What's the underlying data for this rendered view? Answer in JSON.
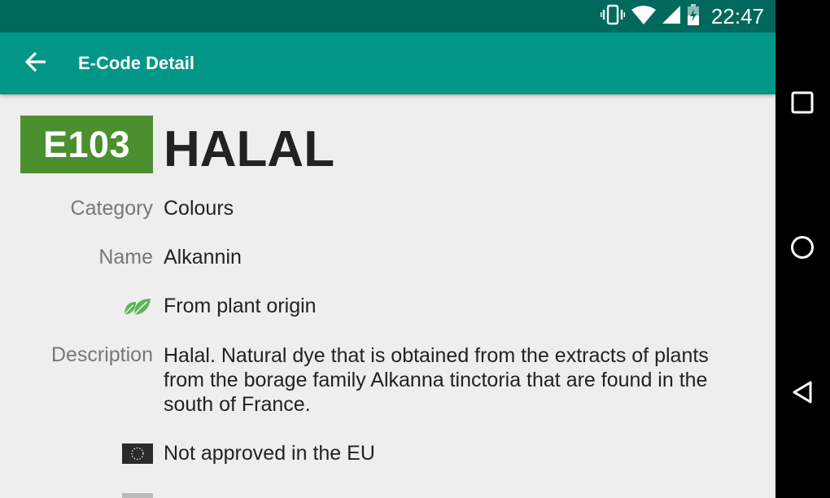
{
  "status_bar": {
    "time": "22:47",
    "icons": [
      "vibrate-icon",
      "wifi-icon",
      "cell-signal-icon",
      "battery-charging-icon"
    ]
  },
  "app_bar": {
    "title": "E-Code Detail",
    "back_icon": "arrow-back-icon"
  },
  "detail": {
    "code": "E103",
    "status": "HALAL",
    "category_label": "Category",
    "category_value": "Colours",
    "name_label": "Name",
    "name_value": "Alkannin",
    "origin_icon": "leaf-icon",
    "origin_text": "From plant origin",
    "description_label": "Description",
    "description_text": "Halal. Natural dye that is obtained from the extracts of plants from the borage family Alkanna tinctoria that are found in the south of France.",
    "eu_icon": "eu-flag-icon",
    "eu_text": "Not approved in the EU"
  },
  "colors": {
    "status_bar": "#00695c",
    "app_bar": "#009688",
    "halal_badge": "#4c8f2f",
    "leaf": "#5ab552"
  },
  "nav_bar": {
    "buttons": [
      "recent-apps-icon",
      "home-icon",
      "back-icon"
    ]
  }
}
